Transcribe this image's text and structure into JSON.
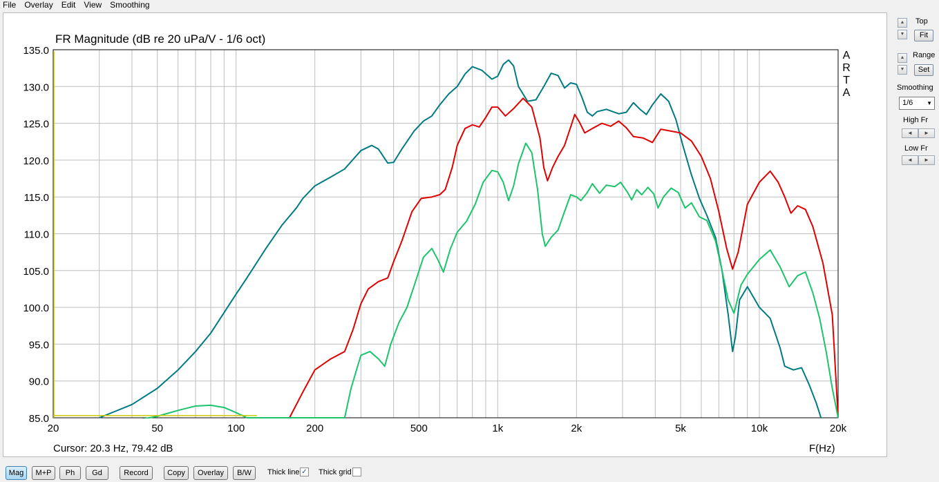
{
  "menu": [
    "File",
    "Overlay",
    "Edit",
    "View",
    "Smoothing"
  ],
  "chart_data": {
    "type": "line",
    "title": "FR Magnitude (dB re 20 uPa/V - 1/6 oct)",
    "xlabel": "F(Hz)",
    "ylabel": "",
    "x_scale": "log",
    "xlim": [
      20,
      20000
    ],
    "ylim": [
      85,
      135
    ],
    "x_ticks": [
      "20",
      "50",
      "100",
      "200",
      "500",
      "1k",
      "2k",
      "5k",
      "10k",
      "20k"
    ],
    "y_ticks": [
      "135.0",
      "130.0",
      "125.0",
      "120.0",
      "115.0",
      "110.0",
      "105.0",
      "100.0",
      "95.0",
      "90.0",
      "85.0"
    ],
    "grid": true,
    "watermark": "ARTA",
    "cursor_text": "Cursor: 20.3 Hz, 79.42 dB",
    "series": [
      {
        "color": "#007a82",
        "points": [
          [
            30,
            85
          ],
          [
            40,
            86.8
          ],
          [
            50,
            89
          ],
          [
            60,
            91.5
          ],
          [
            70,
            94
          ],
          [
            80,
            96.5
          ],
          [
            100,
            101.8
          ],
          [
            110,
            104
          ],
          [
            130,
            108
          ],
          [
            150,
            111.2
          ],
          [
            170,
            113.5
          ],
          [
            180,
            114.8
          ],
          [
            200,
            116.5
          ],
          [
            230,
            117.7
          ],
          [
            260,
            118.8
          ],
          [
            300,
            121.3
          ],
          [
            330,
            122
          ],
          [
            350,
            121.5
          ],
          [
            380,
            119.6
          ],
          [
            400,
            119.7
          ],
          [
            430,
            121.5
          ],
          [
            480,
            124
          ],
          [
            520,
            125.3
          ],
          [
            560,
            126
          ],
          [
            600,
            127.5
          ],
          [
            650,
            129
          ],
          [
            700,
            130
          ],
          [
            750,
            131.7
          ],
          [
            800,
            132.7
          ],
          [
            870,
            132.2
          ],
          [
            950,
            131
          ],
          [
            1000,
            131.4
          ],
          [
            1050,
            133
          ],
          [
            1100,
            133.6
          ],
          [
            1150,
            132.8
          ],
          [
            1200,
            130
          ],
          [
            1300,
            128
          ],
          [
            1400,
            128.2
          ],
          [
            1500,
            130
          ],
          [
            1600,
            131.8
          ],
          [
            1700,
            131.5
          ],
          [
            1800,
            129.8
          ],
          [
            1900,
            130.5
          ],
          [
            2000,
            130.3
          ],
          [
            2100,
            128.5
          ],
          [
            2200,
            126.5
          ],
          [
            2300,
            126
          ],
          [
            2400,
            126.6
          ],
          [
            2600,
            126.9
          ],
          [
            2900,
            126.3
          ],
          [
            3100,
            126.5
          ],
          [
            3300,
            127.8
          ],
          [
            3500,
            126.9
          ],
          [
            3700,
            126.2
          ],
          [
            3900,
            127.5
          ],
          [
            4200,
            129
          ],
          [
            4500,
            128
          ],
          [
            4800,
            125.5
          ],
          [
            5100,
            122
          ],
          [
            5500,
            118
          ],
          [
            5900,
            114.8
          ],
          [
            6300,
            112.5
          ],
          [
            6800,
            109.5
          ],
          [
            7200,
            105
          ],
          [
            7600,
            99
          ],
          [
            7900,
            94
          ],
          [
            8100,
            96
          ],
          [
            8400,
            101
          ],
          [
            9000,
            102.8
          ],
          [
            10000,
            100
          ],
          [
            11000,
            98.5
          ],
          [
            12000,
            94.5
          ],
          [
            12500,
            92
          ],
          [
            13500,
            91.5
          ],
          [
            14500,
            91.8
          ],
          [
            15500,
            89.5
          ],
          [
            16500,
            87
          ],
          [
            17200,
            85
          ]
        ]
      },
      {
        "color": "#e00000",
        "points": [
          [
            160,
            85
          ],
          [
            180,
            88.5
          ],
          [
            200,
            91.5
          ],
          [
            230,
            93
          ],
          [
            260,
            94
          ],
          [
            280,
            97
          ],
          [
            300,
            100.5
          ],
          [
            320,
            102.5
          ],
          [
            350,
            103.5
          ],
          [
            380,
            104
          ],
          [
            400,
            106.2
          ],
          [
            430,
            109
          ],
          [
            470,
            113
          ],
          [
            510,
            114.8
          ],
          [
            560,
            115
          ],
          [
            600,
            115.3
          ],
          [
            630,
            116
          ],
          [
            670,
            119
          ],
          [
            700,
            122
          ],
          [
            750,
            124.3
          ],
          [
            800,
            124.8
          ],
          [
            850,
            124.5
          ],
          [
            900,
            125.8
          ],
          [
            950,
            127.2
          ],
          [
            1000,
            127.2
          ],
          [
            1070,
            126
          ],
          [
            1150,
            127
          ],
          [
            1250,
            128.4
          ],
          [
            1350,
            127.2
          ],
          [
            1450,
            123
          ],
          [
            1500,
            119
          ],
          [
            1550,
            117.2
          ],
          [
            1620,
            119
          ],
          [
            1700,
            120.5
          ],
          [
            1800,
            122
          ],
          [
            1900,
            124.5
          ],
          [
            1970,
            126.2
          ],
          [
            2050,
            125.2
          ],
          [
            2150,
            123.7
          ],
          [
            2300,
            124.3
          ],
          [
            2500,
            125
          ],
          [
            2700,
            124.6
          ],
          [
            2900,
            125.3
          ],
          [
            3100,
            124.4
          ],
          [
            3300,
            123.2
          ],
          [
            3600,
            123
          ],
          [
            3900,
            122.4
          ],
          [
            4200,
            124.2
          ],
          [
            4500,
            124
          ],
          [
            5000,
            123.7
          ],
          [
            5500,
            122.6
          ],
          [
            6000,
            120.5
          ],
          [
            6500,
            117.5
          ],
          [
            7000,
            113
          ],
          [
            7500,
            108
          ],
          [
            7900,
            105.2
          ],
          [
            8300,
            107.5
          ],
          [
            9000,
            114
          ],
          [
            10000,
            117
          ],
          [
            11000,
            118.5
          ],
          [
            11800,
            117
          ],
          [
            12500,
            115
          ],
          [
            13200,
            112.8
          ],
          [
            14000,
            113.8
          ],
          [
            15000,
            113.3
          ],
          [
            16000,
            111
          ],
          [
            17500,
            106
          ],
          [
            19000,
            99
          ],
          [
            20000,
            85
          ]
        ]
      },
      {
        "color": "#1bc46a",
        "points": [
          [
            28,
            83
          ],
          [
            35,
            84.2
          ],
          [
            50,
            85.2
          ],
          [
            60,
            86
          ],
          [
            70,
            86.6
          ],
          [
            80,
            86.7
          ],
          [
            90,
            86.4
          ],
          [
            100,
            85.7
          ],
          [
            110,
            85
          ],
          [
            260,
            85
          ],
          [
            275,
            89
          ],
          [
            300,
            93.5
          ],
          [
            325,
            94
          ],
          [
            350,
            93
          ],
          [
            370,
            92
          ],
          [
            390,
            95
          ],
          [
            420,
            98
          ],
          [
            450,
            100
          ],
          [
            480,
            103
          ],
          [
            520,
            106.8
          ],
          [
            560,
            108
          ],
          [
            590,
            106.5
          ],
          [
            620,
            104.8
          ],
          [
            660,
            108
          ],
          [
            700,
            110.2
          ],
          [
            760,
            111.7
          ],
          [
            820,
            114
          ],
          [
            880,
            117
          ],
          [
            950,
            118.6
          ],
          [
            1000,
            118.4
          ],
          [
            1050,
            117
          ],
          [
            1100,
            114.5
          ],
          [
            1150,
            116.5
          ],
          [
            1200,
            119.5
          ],
          [
            1280,
            122.3
          ],
          [
            1350,
            121
          ],
          [
            1420,
            116
          ],
          [
            1480,
            110
          ],
          [
            1520,
            108.3
          ],
          [
            1600,
            109.5
          ],
          [
            1700,
            110.5
          ],
          [
            1800,
            113
          ],
          [
            1900,
            115.3
          ],
          [
            2000,
            115
          ],
          [
            2080,
            114.5
          ],
          [
            2200,
            115.6
          ],
          [
            2300,
            116.8
          ],
          [
            2450,
            115.5
          ],
          [
            2600,
            116.6
          ],
          [
            2800,
            116.4
          ],
          [
            2950,
            117
          ],
          [
            3150,
            115.5
          ],
          [
            3250,
            114.6
          ],
          [
            3400,
            116
          ],
          [
            3550,
            115.3
          ],
          [
            3750,
            116.3
          ],
          [
            3950,
            115.4
          ],
          [
            4100,
            113.5
          ],
          [
            4300,
            115
          ],
          [
            4600,
            116.2
          ],
          [
            4900,
            115.6
          ],
          [
            5200,
            113.5
          ],
          [
            5500,
            114.2
          ],
          [
            5900,
            112.3
          ],
          [
            6300,
            111.8
          ],
          [
            6800,
            109
          ],
          [
            7200,
            105
          ],
          [
            7600,
            101
          ],
          [
            8000,
            99.2
          ],
          [
            8500,
            103
          ],
          [
            9000,
            104.5
          ],
          [
            10000,
            106.5
          ],
          [
            11000,
            107.8
          ],
          [
            12000,
            105.5
          ],
          [
            13000,
            102.8
          ],
          [
            14000,
            104.3
          ],
          [
            15000,
            104.8
          ],
          [
            16000,
            102
          ],
          [
            17000,
            98.5
          ],
          [
            18000,
            94
          ],
          [
            19000,
            89
          ],
          [
            20000,
            85
          ]
        ]
      },
      {
        "color": "#cccc00",
        "points": [
          [
            20,
            85.3
          ],
          [
            120,
            85.3
          ]
        ]
      }
    ]
  },
  "panel": {
    "top_label": "Top",
    "fit_label": "Fit",
    "range_label": "Range",
    "set_label": "Set",
    "smoothing_label": "Smoothing",
    "smoothing_value": "1/6",
    "high_fr_label": "High Fr",
    "low_fr_label": "Low Fr"
  },
  "toolbar": {
    "mag": "Mag",
    "mp": "M+P",
    "ph": "Ph",
    "gd": "Gd",
    "record": "Record",
    "copy": "Copy",
    "overlay": "Overlay",
    "bw": "B/W",
    "thick_line": "Thick line",
    "thick_line_checked": true,
    "thick_grid": "Thick grid",
    "thick_grid_checked": false
  },
  "colors": {
    "grid": "#bdbdbd",
    "axis": "#000000"
  }
}
